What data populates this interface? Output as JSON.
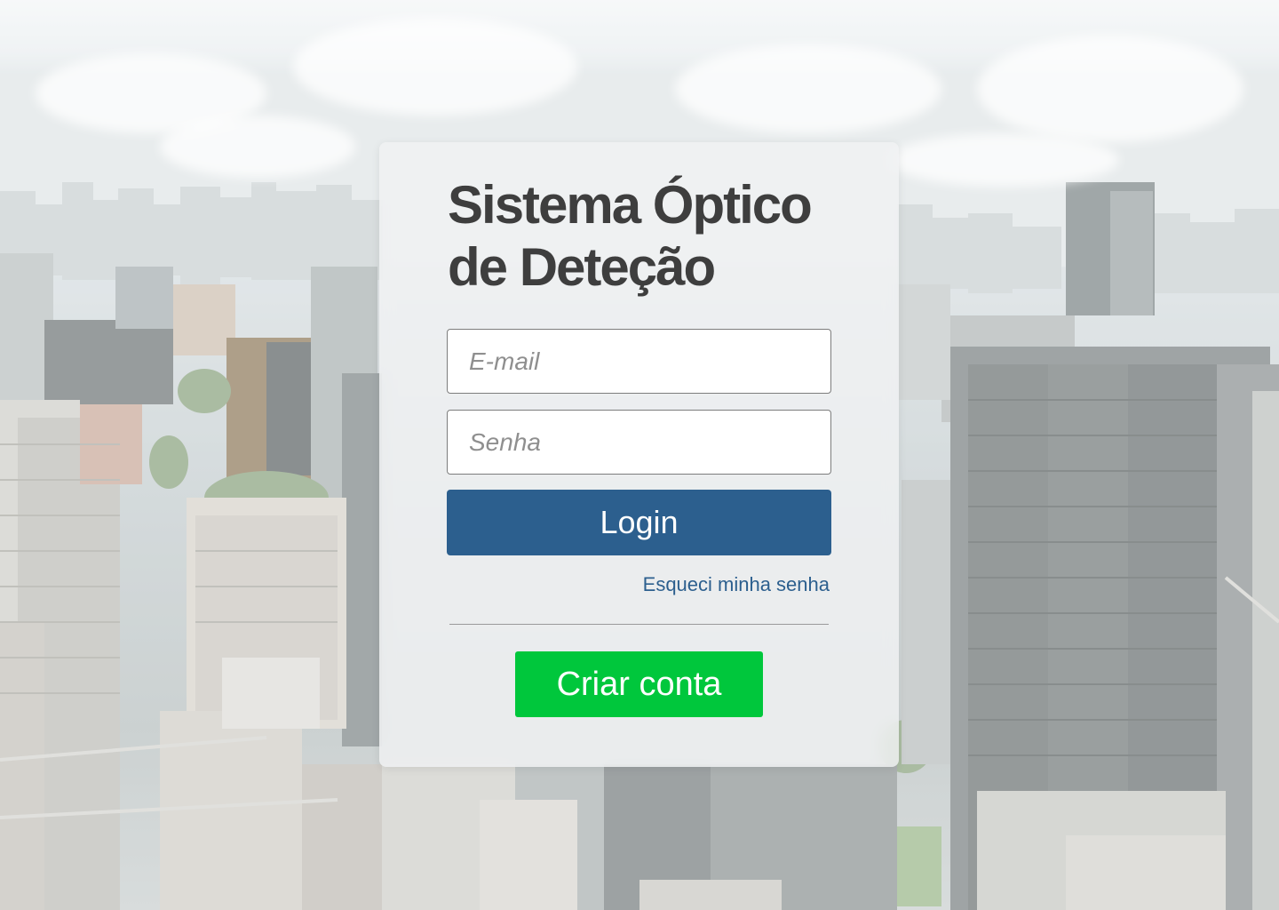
{
  "login_card": {
    "title": "Sistema Óptico de Deteção",
    "email_placeholder": "E-mail",
    "password_placeholder": "Senha",
    "login_label": "Login",
    "forgot_password_label": "Esqueci minha senha",
    "create_account_label": "Criar conta"
  },
  "colors": {
    "primary": "#2c5f8e",
    "success": "#00c73c",
    "title_text": "#3e3e3e"
  }
}
